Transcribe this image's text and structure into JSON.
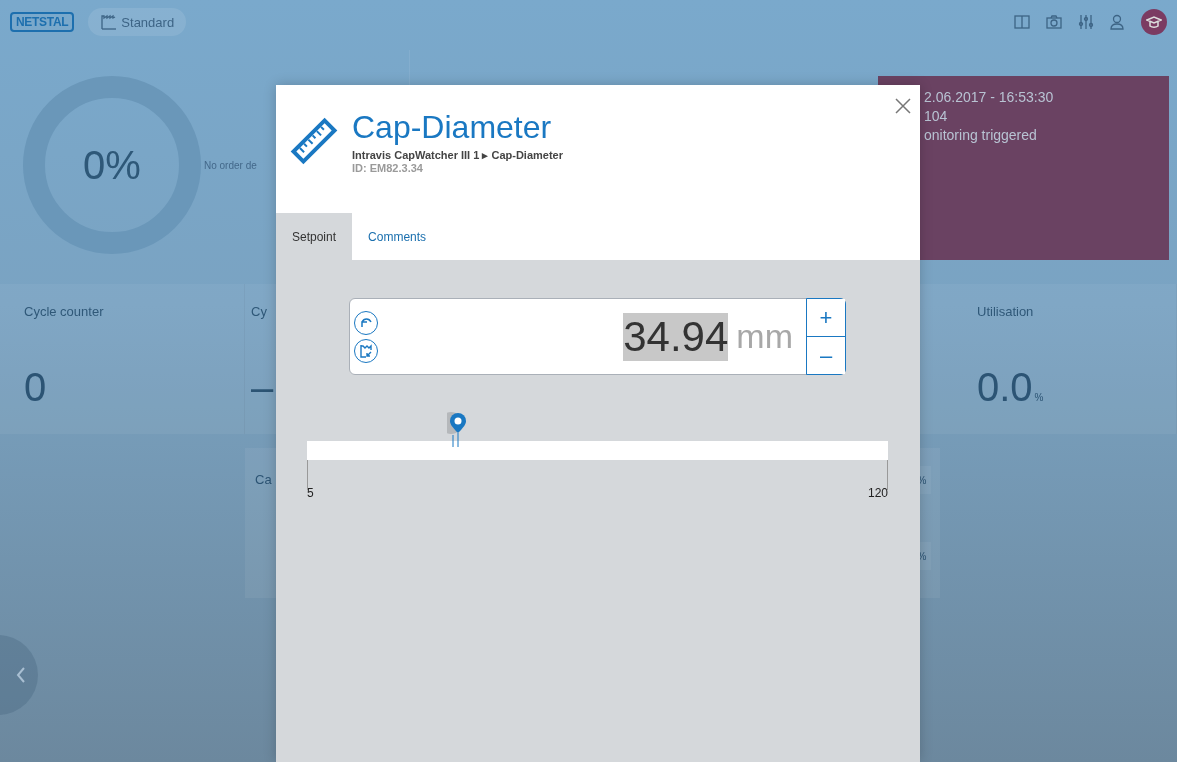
{
  "top_bar": {
    "logo": "NETSTAL",
    "mode": "Standard"
  },
  "overview": {
    "progress": "0%",
    "order_info": "No order de",
    "alert": {
      "time": "2.06.2017 - 16:53:30",
      "code": "104",
      "message": "onitoring triggered"
    }
  },
  "tiles": [
    {
      "label": "Cycle counter",
      "value": "0"
    },
    {
      "label": "Cy",
      "value": "–"
    },
    {
      "label": "Utilisation",
      "value": "0.0",
      "unit": "%"
    }
  ],
  "lower_card": {
    "label": "Ca",
    "badges": [
      "%",
      "%"
    ]
  },
  "dialog": {
    "title": "Cap-Diameter",
    "path": "Intravis CapWatcher III 1 ▸ Cap-Diameter",
    "id": "ID: EM82.3.34",
    "tabs": [
      {
        "label": "Setpoint",
        "selected": true
      },
      {
        "label": "Comments",
        "selected": false
      }
    ],
    "field": {
      "value": "34.94",
      "unit": "mm",
      "value_selected": true,
      "plus": "+",
      "minus": "–"
    },
    "slider": {
      "min": "5",
      "max": "120",
      "level": 0.26
    }
  }
}
